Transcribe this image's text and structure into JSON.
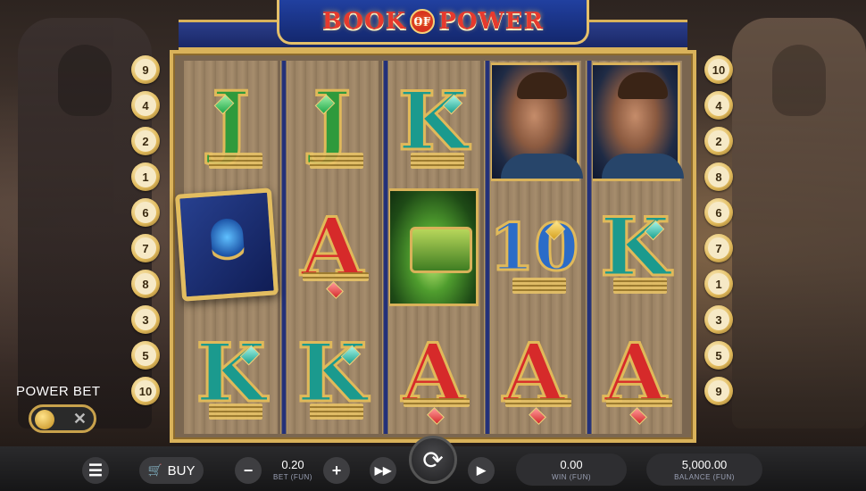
{
  "game": {
    "title_left": "BOOK",
    "title_of": "OF",
    "title_right": "POWER"
  },
  "paylines": {
    "left": [
      "9",
      "4",
      "2",
      "1",
      "6",
      "7",
      "8",
      "3",
      "5",
      "10"
    ],
    "right": [
      "10",
      "4",
      "2",
      "8",
      "6",
      "7",
      "1",
      "3",
      "5",
      "9"
    ]
  },
  "reels": [
    [
      "J",
      "BOOK",
      "K"
    ],
    [
      "J",
      "A",
      "K"
    ],
    [
      "K",
      "CHEST",
      "A"
    ],
    [
      "PORTRAIT",
      "10",
      "A"
    ],
    [
      "PORTRAIT",
      "K",
      "A"
    ]
  ],
  "power_bet": {
    "label": "POWER BET",
    "enabled": false
  },
  "controls": {
    "menu_icon": "hamburger-icon",
    "buy_label": "BUY",
    "bet_value": "0.20",
    "bet_caption": "BET (FUN)",
    "win_value": "0.00",
    "win_caption": "WIN (FUN)",
    "balance_value": "5,000.00",
    "balance_caption": "BALANCE (FUN)"
  },
  "colors": {
    "gold": "#d9b25a",
    "blue": "#22307a",
    "red": "#e63a2e"
  }
}
